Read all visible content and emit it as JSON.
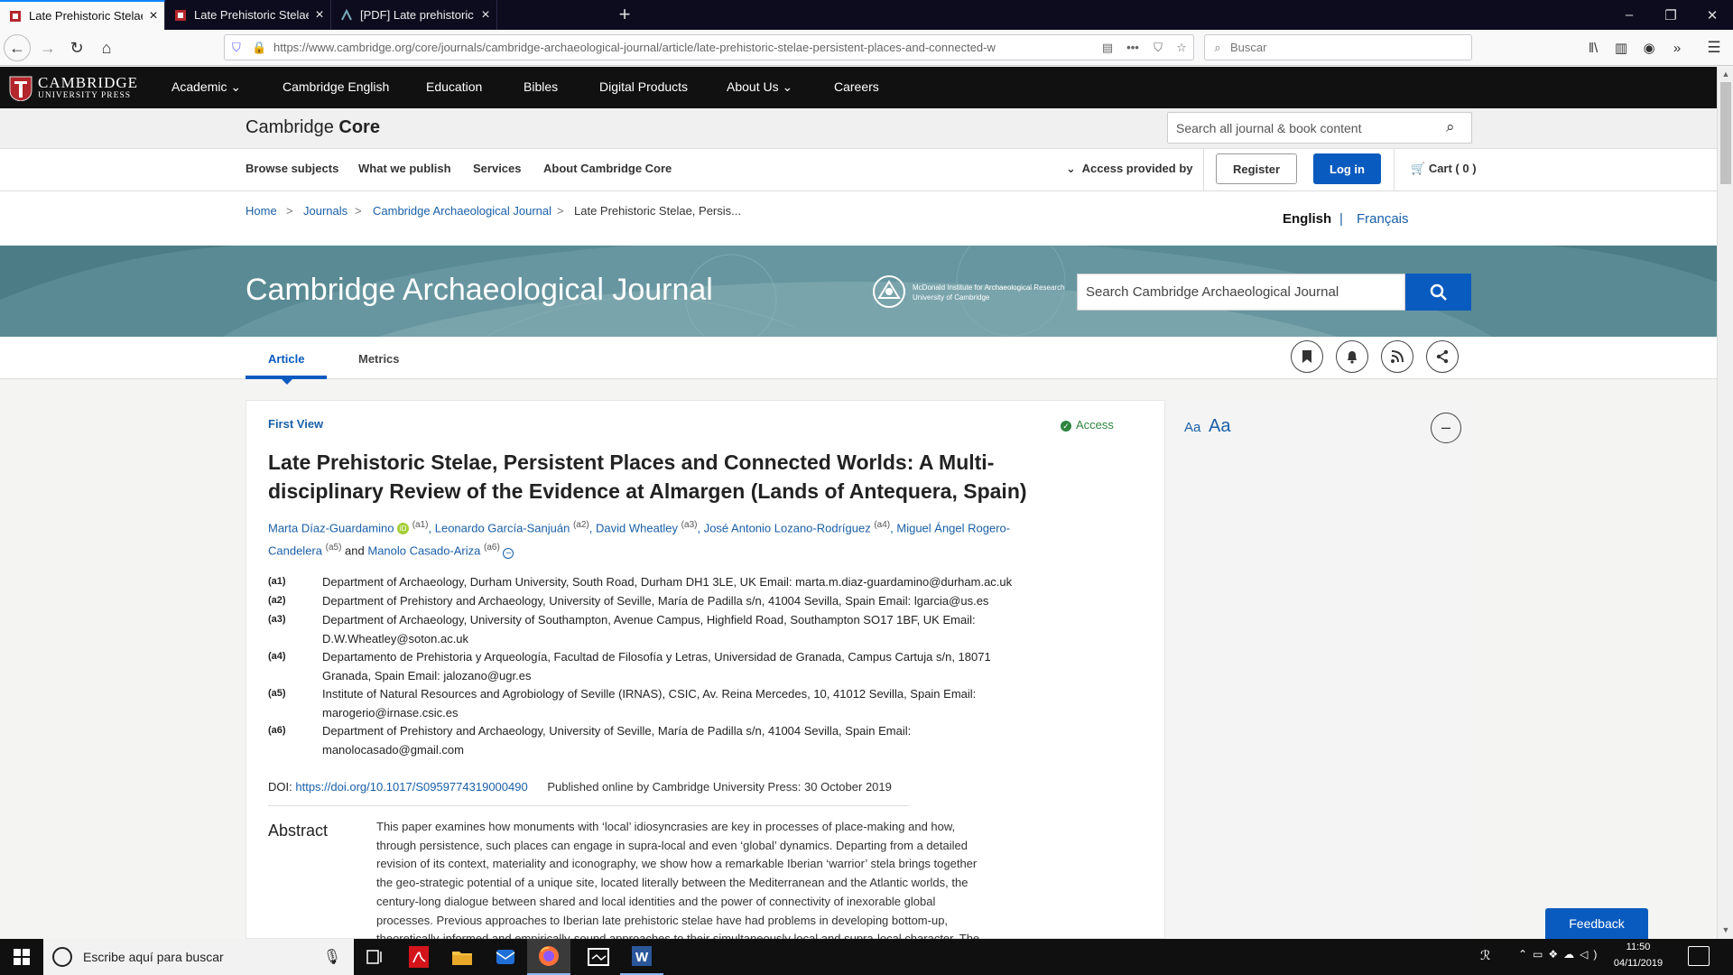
{
  "browser": {
    "tabs": [
      {
        "label": "Late Prehistoric Stelae, Persistent"
      },
      {
        "label": "Late Prehistoric Stelae, Persistent"
      },
      {
        "label": "[PDF] Late prehistoric stelae, pe"
      }
    ],
    "url": "https://www.cambridge.org/core/journals/cambridge-archaeological-journal/article/late-prehistoric-stelae-persistent-places-and-connected-w",
    "search_placeholder": "Buscar"
  },
  "site": {
    "logo_main": "CAMBRIDGE",
    "logo_sub": "UNIVERSITY PRESS",
    "nav": [
      "Academic",
      "Cambridge English",
      "Education",
      "Bibles",
      "Digital Products",
      "About Us",
      "Careers"
    ],
    "core_logo_a": "Cambridge",
    "core_logo_b": "Core",
    "core_search_placeholder": "Search all journal & book content",
    "subnav": [
      "Browse subjects",
      "What we publish",
      "Services",
      "About Cambridge Core"
    ],
    "access": "Access provided by",
    "register": "Register",
    "login": "Log in",
    "cart": "Cart ( 0 )"
  },
  "breadcrumb": {
    "items": [
      "Home",
      "Journals",
      "Cambridge Archaeological Journal",
      "Late Prehistoric Stelae, Persis..."
    ],
    "sep": ">"
  },
  "language": {
    "en": "English",
    "sep": "|",
    "fr": "Français"
  },
  "journal": {
    "title": "Cambridge Archaeological Journal",
    "institute_line1": "McDonald Institute for Archaeological Research",
    "institute_line2": "University of Cambridge",
    "search_placeholder": "Search Cambridge Archaeological Journal"
  },
  "tabs": {
    "article": "Article",
    "metrics": "Metrics"
  },
  "article": {
    "first_view": "First View",
    "access": "Access",
    "title_line1": "Late Prehistoric Stelae, Persistent Places and Connected Worlds: A Multi-",
    "title_line2": "disciplinary Review of the Evidence at Almargen (Lands of Antequera, Spain)",
    "authors": [
      {
        "name": "Marta Díaz-Guardamino",
        "aff": "(a1)"
      },
      {
        "name": "Leonardo García-Sanjuán",
        "aff": "(a2)"
      },
      {
        "name": "David Wheatley",
        "aff": "(a3)"
      },
      {
        "name": "José Antonio Lozano-Rodríguez",
        "aff": "(a4)"
      },
      {
        "name": "Miguel Ángel Rogero-",
        "aff": ""
      },
      {
        "name": "Candelera",
        "aff": "(a5)"
      },
      {
        "name": "Manolo Casado-Ariza",
        "aff": "(a6)"
      }
    ],
    "and": "and",
    "affiliations": [
      {
        "code": "(a1)",
        "lines": [
          "Department of Archaeology, Durham University, South Road, Durham DH1 3LE, UK Email: marta.m.diaz-guardamino@durham.ac.uk"
        ]
      },
      {
        "code": "(a2)",
        "lines": [
          "Department of Prehistory and Archaeology, University of Seville, María de Padilla s/n, 41004 Sevilla, Spain Email: lgarcia@us.es"
        ]
      },
      {
        "code": "(a3)",
        "lines": [
          "Department of Archaeology, University of Southampton, Avenue Campus, Highfield Road, Southampton SO17 1BF, UK Email:",
          "D.W.Wheatley@soton.ac.uk"
        ]
      },
      {
        "code": "(a4)",
        "lines": [
          "Departamento de Prehistoria y Arqueología, Facultad de Filosofía y Letras, Universidad de Granada, Campus Cartuja s/n, 18071",
          "Granada, Spain Email: jalozano@ugr.es"
        ]
      },
      {
        "code": "(a5)",
        "lines": [
          "Institute of Natural Resources and Agrobiology of Seville (IRNAS), CSIC, Av. Reina Mercedes, 10, 41012 Sevilla, Spain Email:",
          "marogerio@irnase.csic.es"
        ]
      },
      {
        "code": "(a6)",
        "lines": [
          "Department of Prehistory and Archaeology, University of Seville, María de Padilla s/n, 41004 Sevilla, Spain Email:",
          "manolocasado@gmail.com"
        ]
      }
    ],
    "doi_label": "DOI:",
    "doi": "https://doi.org/10.1017/S0959774319000490",
    "published": "Published online by Cambridge University Press: 30 October 2019",
    "abstract_heading": "Abstract",
    "abstract_lines": [
      "This paper examines how monuments with ‘local’ idiosyncrasies are key in processes of place-making and how,",
      "through persistence, such places can engage in supra-local and even ‘global’ dynamics. Departing from a detailed",
      "revision of its context, materiality and iconography, we show how a remarkable Iberian ‘warrior’ stela brings together",
      "the geo-strategic potential of a unique site, located literally between the Mediterranean and the Atlantic worlds, the",
      "century-long dialogue between shared and local identities and the power of connectivity of inexorable global",
      "processes. Previous approaches to Iberian late prehistoric stelae have had problems in developing bottom-up,",
      "theoretically-informed and empirically-sound approaches to their simultaneously local and supra-local character. The"
    ]
  },
  "reader": {
    "small": "Aa",
    "large": "Aa"
  },
  "feedback": "Feedback",
  "taskbar": {
    "search": "Escribe aquí para buscar",
    "time": "11:50",
    "date": "04/11/2019"
  },
  "colors": {
    "link": "#1a5fa8",
    "login": "#0a5bbf",
    "banner": "#5a8b94",
    "green": "#2e8540"
  }
}
